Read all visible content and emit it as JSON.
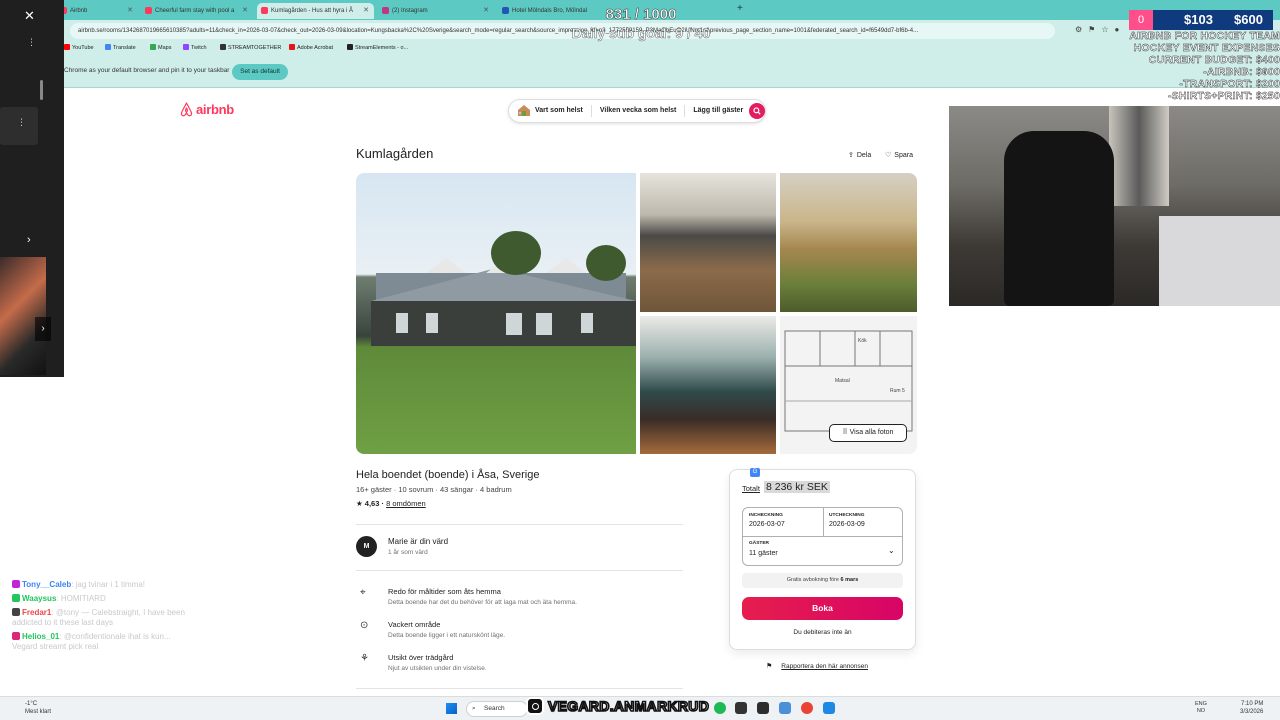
{
  "browser": {
    "tabs": [
      {
        "label": "Airbnb",
        "active": false
      },
      {
        "label": "Cheerful farm stay with pool a",
        "active": false
      },
      {
        "label": "Kumlagården - Hus att hyra i Å",
        "active": true
      },
      {
        "label": "(2) Instagram",
        "active": false
      },
      {
        "label": "Hotel Mölndals Bro, Mölndal",
        "active": false
      }
    ],
    "new_tab": "+",
    "url": "airbnb.se/rooms/1342687019665610385?adults=11&check_in=2026-03-07&check_out=2026-03-09&location=Kungsbacka%2C%20Sverige&search_mode=regular_search&source_impression_id=p3_1772559159_P3MaObEuO2iUNm1s&previous_page_section_name=1001&federated_search_id=f6549dd7-bf6b-4...",
    "bookmarks": [
      "YouTube",
      "Translate",
      "Maps",
      "Twitch",
      "STREAMTOGETHER",
      "Adobe Acrobat",
      "StreamElements - o..."
    ],
    "infobar_message": "Chrome as your default browser and pin it to your taskbar",
    "infobar_button": "Set as default",
    "infobar_close": "×"
  },
  "airbnb": {
    "logo_text": "airbnb",
    "search": {
      "where": "Vart som helst",
      "when": "Vilken vecka som helst",
      "guests": "Lägg till gäster"
    },
    "listing": {
      "title": "Kumlagården",
      "share_label": "Dela",
      "save_label": "Spara",
      "show_all_photos": "Visa alla foton",
      "floorplan_labels": [
        "Kök",
        "Matsal",
        "Rum 5"
      ],
      "subtitle": "Hela boendet (boende) i Åsa, Sverige",
      "meta": "16+ gäster · 10 sovrum · 43 sängar · 4 badrum",
      "rating": "★ 4,63 · ",
      "reviews": "8 omdömen",
      "host_initial": "M",
      "host_name": "Marie är din värd",
      "host_sub": "1 år som värd",
      "amenities": [
        {
          "icon": "utensils-icon",
          "title": "Redo för måltider som åts hemma",
          "desc": "Detta boende har det du behöver för att laga mat och äta hemma."
        },
        {
          "icon": "map-pin-icon",
          "title": "Vackert område",
          "desc": "Detta boende ligger i ett naturskönt läge."
        },
        {
          "icon": "garden-icon",
          "title": "Utsikt över trädgård",
          "desc": "Njut av utsikten under din vistelse."
        }
      ]
    },
    "booking": {
      "total_label": "Totalt",
      "total_value": "8 236 kr SEK",
      "checkin_label": "INCHECKNING",
      "checkin_value": "2026-03-07",
      "checkout_label": "UTCHECKNING",
      "checkout_value": "2026-03-09",
      "guests_label": "GÄSTER",
      "guests_value": "11 gäster",
      "free_cancel_prefix": "Gratis avbokning före ",
      "free_cancel_date": "6 mars",
      "book_button": "Boka",
      "no_charge": "Du debiteras inte än",
      "report": "Rapportera den här annonsen"
    }
  },
  "stream": {
    "sub_count": "831 / 1000",
    "sub_goal": "Daily sub goal: 9 / 40",
    "budget_left": "0",
    "budget_current": "$103",
    "budget_goal": "$600",
    "overlay_lines": [
      "AIRBNB FOR HOCKEY TEAM",
      "HOCKEY EVENT EXPENSES",
      "CURRENT BUDGET: $400",
      "-AIRBNB: $600",
      "-TRANSPORT: $200",
      "-SHIRTS+PRINT: $250"
    ],
    "chat": [
      {
        "user": "Tony__Caleb",
        "color": "#3b82f6",
        "msg": "jag tvinar i 1 timma!"
      },
      {
        "user": "Waaysus",
        "color": "#22c55e",
        "msg": "HOMITIARD"
      },
      {
        "user": "Fredar1",
        "color": "#ef4444",
        "msg": "@tony — Calebstraight, I have been addicted to it these last days"
      },
      {
        "user": "Helios_01",
        "color": "#22c55e",
        "msg": "@confidentionale ihat is kun... Vegard streamt pick real"
      }
    ],
    "ig_handle": "VEGARD.ANMARKRUD"
  },
  "taskbar": {
    "weather_line1": "-1°C",
    "weather_line2": "Mest klart",
    "search_label": "Search",
    "lang_line1": "ENG",
    "lang_line2": "NO",
    "time": "7:10 PM",
    "date": "3/3/2026"
  }
}
